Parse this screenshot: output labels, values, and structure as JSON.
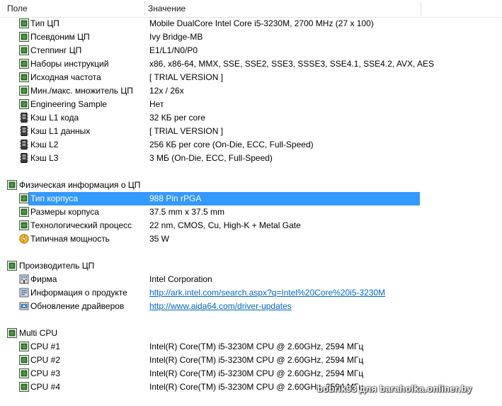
{
  "header": {
    "col1": "Поле",
    "col2": "Значение"
  },
  "rows": [
    {
      "type": "item",
      "icon": "cpu-chip-icon",
      "label": "Тип ЦП",
      "value": "Mobile DualCore Intel Core i5-3230M, 2700 MHz (27 x 100)"
    },
    {
      "type": "item",
      "icon": "cpu-chip-icon",
      "label": "Псевдоним ЦП",
      "value": "Ivy Bridge-MB"
    },
    {
      "type": "item",
      "icon": "cpu-chip-icon",
      "label": "Степпинг ЦП",
      "value": "E1/L1/N0/P0"
    },
    {
      "type": "item",
      "icon": "cpu-chip-icon",
      "label": "Наборы инструкций",
      "value": "x86, x86-64, MMX, SSE, SSE2, SSE3, SSSE3, SSE4.1, SSE4.2, AVX, AES"
    },
    {
      "type": "item",
      "icon": "cpu-chip-icon",
      "label": "Исходная частота",
      "value": "[ TRIAL VERSION ]"
    },
    {
      "type": "item",
      "icon": "cpu-chip-icon",
      "label": "Мин./макс. множитель ЦП",
      "value": "12x / 26x"
    },
    {
      "type": "item",
      "icon": "cpu-chip-icon",
      "label": "Engineering Sample",
      "value": "Нет"
    },
    {
      "type": "item",
      "icon": "memory-stick-icon",
      "label": "Кэш L1 кода",
      "value": "32 КБ per core"
    },
    {
      "type": "item",
      "icon": "memory-stick-icon",
      "label": "Кэш L1 данных",
      "value": "[ TRIAL VERSION ]"
    },
    {
      "type": "item",
      "icon": "memory-stick-icon",
      "label": "Кэш L2",
      "value": "256 КБ per core  (On-Die, ECC, Full-Speed)"
    },
    {
      "type": "item",
      "icon": "memory-stick-icon",
      "label": "Кэш L3",
      "value": "3 МБ  (On-Die, ECC, Full-Speed)"
    },
    {
      "type": "blank"
    },
    {
      "type": "group",
      "icon": "cpu-chip-icon",
      "label": "Физическая информация о ЦП"
    },
    {
      "type": "item",
      "icon": "cpu-chip-icon",
      "label": "Тип корпуса",
      "value": "988 Pin rPGA",
      "selected": true
    },
    {
      "type": "item",
      "icon": "cpu-chip-icon",
      "label": "Размеры корпуса",
      "value": "37.5 mm x 37.5 mm"
    },
    {
      "type": "item",
      "icon": "cpu-chip-icon",
      "label": "Технологический процесс",
      "value": "22 nm, CMOS, Cu, High-K + Metal Gate"
    },
    {
      "type": "item",
      "icon": "power-icon",
      "label": "Типичная мощность",
      "value": "35 W"
    },
    {
      "type": "blank"
    },
    {
      "type": "group",
      "icon": "cpu-chip-icon",
      "label": "Производитель ЦП"
    },
    {
      "type": "item",
      "icon": "building-icon",
      "label": "Фирма",
      "value": "Intel Corporation"
    },
    {
      "type": "item",
      "icon": "info-icon",
      "label": "Информация о продукте",
      "value": "http://ark.intel.com/search.aspx?q=Intel%20Core%20i5-3230M",
      "link": true
    },
    {
      "type": "item",
      "icon": "update-icon",
      "label": "Обновление драйверов",
      "value": "http://www.aida64.com/driver-updates",
      "link": true
    },
    {
      "type": "blank"
    },
    {
      "type": "group",
      "icon": "cpu-chip-icon",
      "label": "Multi CPU"
    },
    {
      "type": "item",
      "icon": "cpu-chip-icon",
      "label": "CPU #1",
      "value": "Intel(R) Core(TM) i5-3230M CPU @ 2.60GHz, 2594 МГц"
    },
    {
      "type": "item",
      "icon": "cpu-chip-icon",
      "label": "CPU #2",
      "value": "Intel(R) Core(TM) i5-3230M CPU @ 2.60GHz, 2594 МГц"
    },
    {
      "type": "item",
      "icon": "cpu-chip-icon",
      "label": "CPU #3",
      "value": "Intel(R) Core(TM) i5-3230M CPU @ 2.60GHz, 2594 МГц"
    },
    {
      "type": "item",
      "icon": "cpu-chip-icon",
      "label": "CPU #4",
      "value": "Intel(R) Core(TM) i5-3230M CPU @ 2.60GHz, 2594 МГц"
    }
  ],
  "watermark": "bobrik93 для baraholka.onliner.by",
  "colors": {
    "selection": "#3399ff",
    "link": "#0066cc",
    "chip": "#2f6e2a"
  }
}
